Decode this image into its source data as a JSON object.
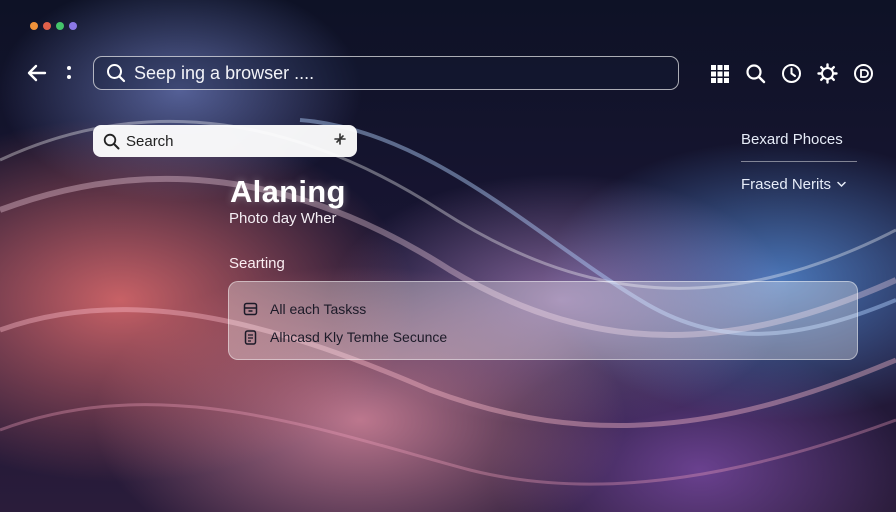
{
  "window": {
    "traffic_lights": [
      "#f0923a",
      "#e0604a",
      "#44c46a",
      "#8b78e6"
    ]
  },
  "toolbar": {
    "back_icon": "arrow-left-icon",
    "menu_icon": "vertical-dots-icon",
    "url_text": "Seep ing a browser ....",
    "icons": [
      "grid-icon",
      "search-icon",
      "clock-icon",
      "gear-icon",
      "account-icon"
    ]
  },
  "search": {
    "label": "Search",
    "action_icon": "pin-icon"
  },
  "hero": {
    "title": "Alaning",
    "subtitle": "Photo day Wher"
  },
  "results_section": {
    "label": "Searting",
    "items": [
      {
        "icon": "archive-icon",
        "label": "All each Taskss"
      },
      {
        "icon": "document-icon",
        "label": "Alhcasd Kly Temhe Secunce"
      }
    ]
  },
  "side_panel": {
    "primary": "Bexard Phoces",
    "secondary": "Frased Nerits",
    "secondary_icon": "chevron-down-icon"
  }
}
